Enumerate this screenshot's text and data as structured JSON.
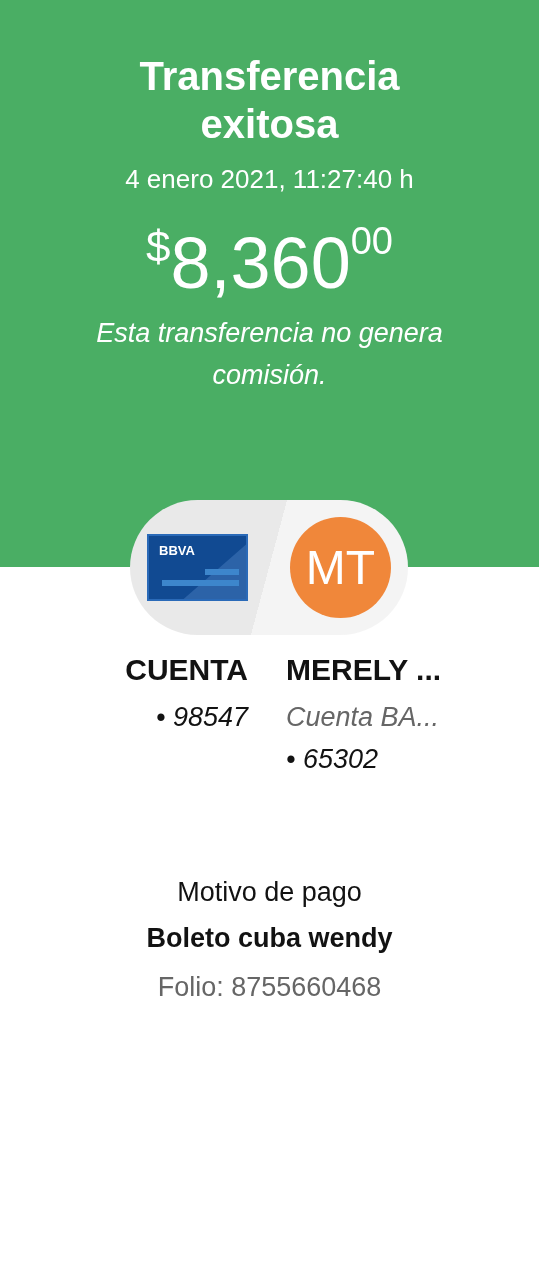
{
  "header": {
    "title": "Transferencia exitosa",
    "datetime": "4 enero 2021, 11:27:40 h",
    "amount": {
      "currency": "$",
      "whole": "8,360",
      "cents": "00"
    },
    "note": "Esta transferencia no genera comisión."
  },
  "origin": {
    "card_label": "BBVA",
    "name": "CUENTA",
    "account": "• 98547"
  },
  "destination": {
    "initials": "MT",
    "color": "#f0873a",
    "name": "MERELY ...",
    "bank": "Cuenta BA...",
    "account": "• 65302"
  },
  "payment": {
    "label": "Motivo de pago",
    "reason": "Boleto cuba wendy",
    "folio": "Folio: 8755660468"
  }
}
